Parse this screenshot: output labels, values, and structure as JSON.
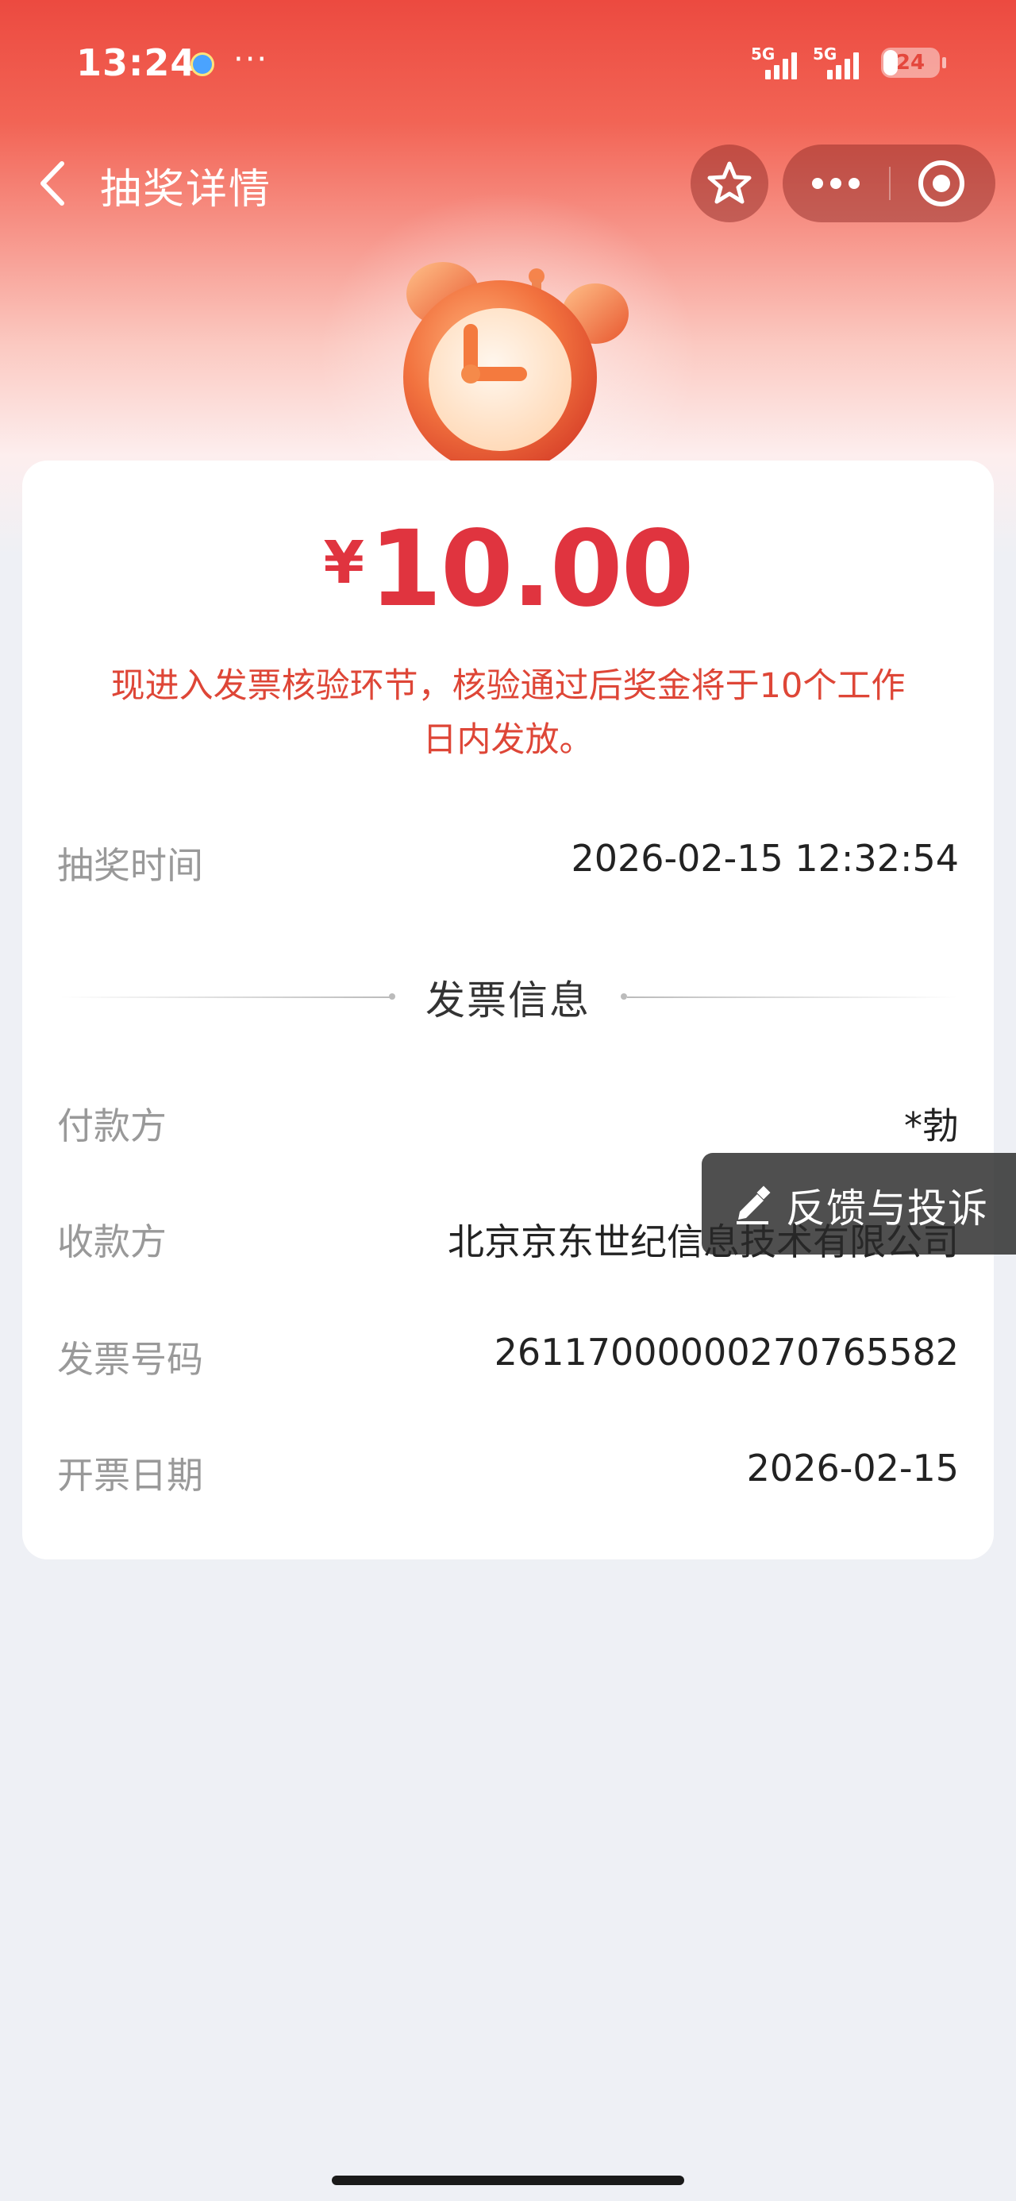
{
  "status_bar": {
    "time": "13:24",
    "more": "···",
    "signal_1_label": "5G",
    "signal_2_label": "5G",
    "battery": "24",
    "app_icon": "app-notification-icon"
  },
  "nav": {
    "back_icon": "chevron-left-icon",
    "title": "抽奖详情",
    "favorite_icon": "star-icon",
    "more_icon": "more-dots-icon",
    "close_icon": "target-close-icon"
  },
  "hero": {
    "illustration": "alarm-clock-icon"
  },
  "prize": {
    "currency": "¥",
    "amount": "10.00",
    "notice": "现进入发票核验环节，核验通过后奖金将于10个工作日内发放。"
  },
  "draw_info": {
    "draw_time_label": "抽奖时间",
    "draw_time_value": "2026-02-15 12:32:54"
  },
  "invoice": {
    "section_title": "发票信息",
    "payer_label": "付款方",
    "payer_value": "*勃",
    "payee_label": "收款方",
    "payee_value": "北京京东世纪信息技术有限公司",
    "invoice_no_label": "发票号码",
    "invoice_no_value": "26117000000270765582",
    "issue_date_label": "开票日期",
    "issue_date_value": "2026-02-15"
  },
  "feedback": {
    "label": "反馈与投诉",
    "icon": "pencil-icon"
  },
  "colors": {
    "brand_red": "#e4473d",
    "amount_red": "#e0343f",
    "page_bg": "#eef0f5"
  }
}
